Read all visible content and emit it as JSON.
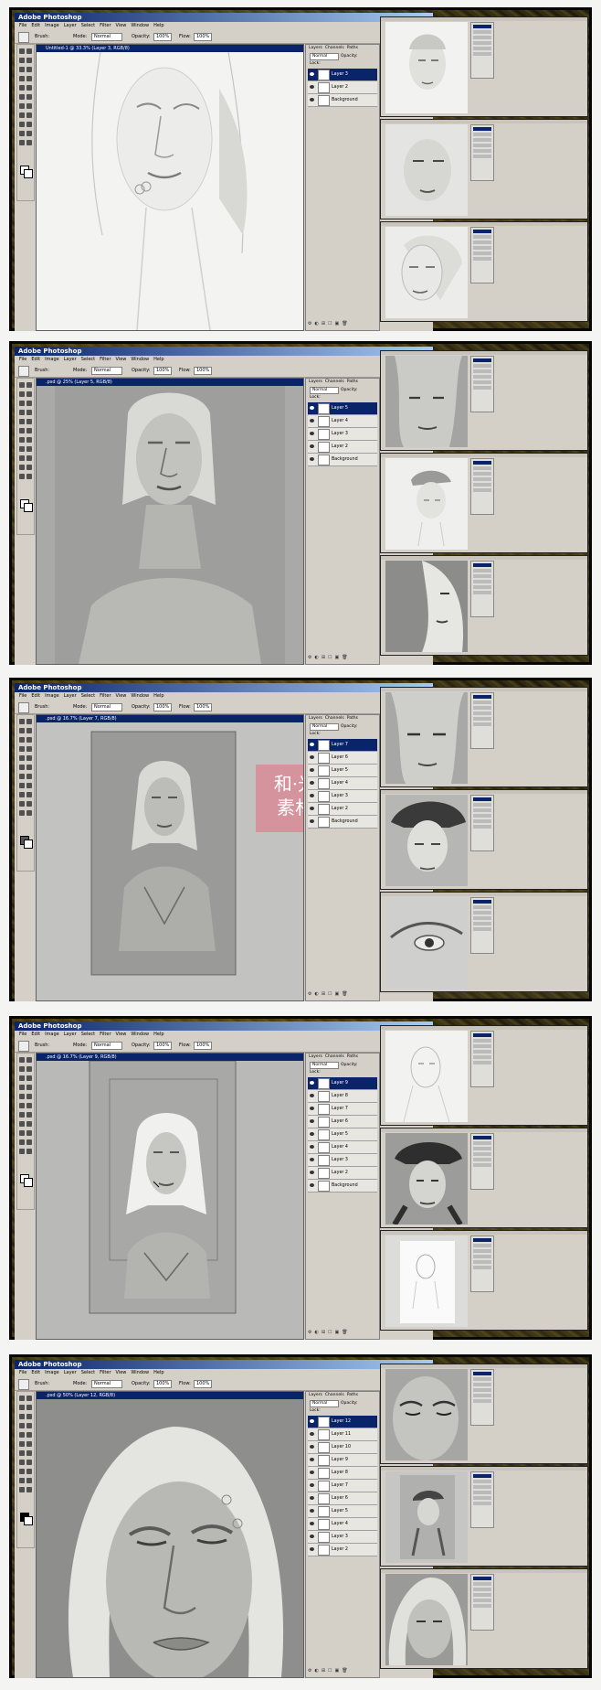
{
  "app": {
    "title": "Adobe Photoshop",
    "menu": [
      "File",
      "Edit",
      "Image",
      "Layer",
      "Select",
      "Filter",
      "View",
      "Window",
      "Help"
    ],
    "options": {
      "brush_label": "Brush:",
      "mode_label": "Mode:",
      "mode_value": "Normal",
      "opacity_label": "Opacity:",
      "flow_label": "Flow:"
    },
    "palette_tab": "Brushes Tool Presets Comps"
  },
  "layers_panel": {
    "tabs": [
      "Layers",
      "Channels",
      "Paths"
    ],
    "blend": "Normal",
    "opacity_label": "Opacity:",
    "lock_label": "Lock:",
    "fill_label": "Fill:"
  },
  "panels": [
    {
      "doc_title": "Untitled-1 @ 33.3% (Layer 3, RGB/8)",
      "opacity": "100%",
      "flow": "100%",
      "layers": [
        {
          "name": "Layer 3",
          "selected": true
        },
        {
          "name": "Layer 2",
          "selected": false
        },
        {
          "name": "Background",
          "selected": false
        }
      ],
      "art": "sketch-light"
    },
    {
      "doc_title": ".psd @ 25% (Layer 5, RGB/8)",
      "opacity": "100%",
      "flow": "100%",
      "layers": [
        {
          "name": "Layer 5",
          "selected": true
        },
        {
          "name": "Layer 4",
          "selected": false
        },
        {
          "name": "Layer 3",
          "selected": false
        },
        {
          "name": "Layer 2",
          "selected": false
        },
        {
          "name": "Background",
          "selected": false
        }
      ],
      "art": "gray-portrait"
    },
    {
      "doc_title": ".psd @ 16.7% (Layer 7, RGB/8)",
      "opacity": "100%",
      "flow": "100%",
      "layers": [
        {
          "name": "Layer 7",
          "selected": true
        },
        {
          "name": "Layer 6",
          "selected": false
        },
        {
          "name": "Layer 5",
          "selected": false
        },
        {
          "name": "Layer 4",
          "selected": false
        },
        {
          "name": "Layer 3",
          "selected": false
        },
        {
          "name": "Layer 2",
          "selected": false
        },
        {
          "name": "Background",
          "selected": false
        }
      ],
      "art": "framed-small",
      "watermark": "和·光\n素材"
    },
    {
      "doc_title": ".psd @ 16.7% (Layer 9, RGB/8)",
      "opacity": "100%",
      "flow": "100%",
      "layers": [
        {
          "name": "Layer 9",
          "selected": true
        },
        {
          "name": "Layer 8",
          "selected": false
        },
        {
          "name": "Layer 7",
          "selected": false
        },
        {
          "name": "Layer 6",
          "selected": false
        },
        {
          "name": "Layer 5",
          "selected": false
        },
        {
          "name": "Layer 4",
          "selected": false
        },
        {
          "name": "Layer 3",
          "selected": false
        },
        {
          "name": "Layer 2",
          "selected": false
        },
        {
          "name": "Background",
          "selected": false
        }
      ],
      "art": "framed-bright"
    },
    {
      "doc_title": ".psd @ 50% (Layer 12, RGB/8)",
      "opacity": "100%",
      "flow": "100%",
      "layers": [
        {
          "name": "Layer 12",
          "selected": true
        },
        {
          "name": "Layer 11",
          "selected": false
        },
        {
          "name": "Layer 10",
          "selected": false
        },
        {
          "name": "Layer 9",
          "selected": false
        },
        {
          "name": "Layer 8",
          "selected": false
        },
        {
          "name": "Layer 7",
          "selected": false
        },
        {
          "name": "Layer 6",
          "selected": false
        },
        {
          "name": "Layer 5",
          "selected": false
        },
        {
          "name": "Layer 4",
          "selected": false
        },
        {
          "name": "Layer 3",
          "selected": false
        },
        {
          "name": "Layer 2",
          "selected": false
        }
      ],
      "art": "closeup"
    }
  ],
  "colors": {
    "titlebar": "#0a246a",
    "chrome": "#d4d0c8",
    "watermark": "#e66e82"
  }
}
